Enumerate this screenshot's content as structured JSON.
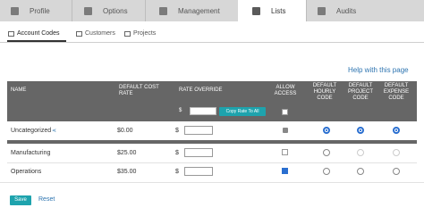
{
  "nav": {
    "tabs": [
      {
        "label": "Profile",
        "icon": "user-icon"
      },
      {
        "label": "Options",
        "icon": "sliders-icon"
      },
      {
        "label": "Management",
        "icon": "badge-icon"
      },
      {
        "label": "Lists",
        "icon": "list-icon",
        "active": true
      },
      {
        "label": "Audits",
        "icon": "calendar-icon"
      }
    ]
  },
  "subnav": {
    "items": [
      {
        "label": "Account Codes",
        "active": true
      },
      {
        "label": "Customers"
      },
      {
        "label": "Projects"
      }
    ]
  },
  "help_link": "Help with this page",
  "table": {
    "headers": {
      "name": "NAME",
      "default_cost_rate": "DEFAULT COST RATE",
      "rate_override": "RATE OVERRIDE",
      "allow_access": "ALLOW ACCESS",
      "default_hourly_code": "DEFAULT HOURLY CODE",
      "default_project_code": "DEFAULT PROJECT CODE",
      "default_expense_code": "DEFAULT EXPENSE CODE"
    },
    "header_rate_prefix": "$",
    "copy_rate_label": "Copy Rate To All",
    "currency_symbol": "$",
    "rows": [
      {
        "name": "Uncategorized",
        "cost_rate": "$0.00"
      },
      {
        "name": "Manufacturing",
        "cost_rate": "$25.00"
      },
      {
        "name": "Operations",
        "cost_rate": "$35.00"
      }
    ]
  },
  "actions": {
    "save_label": "Save",
    "reset_label": "Reset"
  },
  "colors": {
    "accent": "#1ea3ad",
    "link": "#2d74b0",
    "header_bg": "#666666"
  }
}
